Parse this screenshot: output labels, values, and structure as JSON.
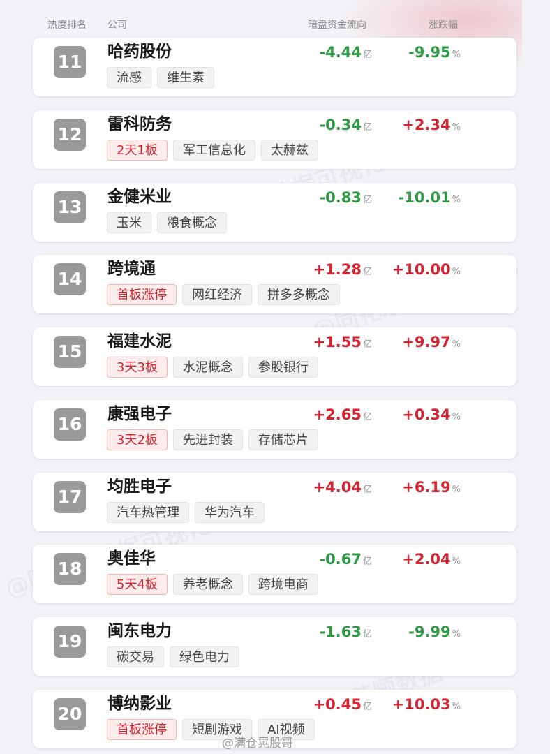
{
  "header": {
    "rank_label": "热度排名",
    "company_label": "公司",
    "flow_label": "暗盘资金流向",
    "change_label": "涨跌幅"
  },
  "unit_flow": "亿",
  "unit_change": "%",
  "watermark": "@同花顺数据可视化",
  "footer_mark": "@满仓晃股哥",
  "rows": [
    {
      "rank": "11",
      "name": "哈药股份",
      "flow": "-4.44",
      "change": "-9.95",
      "tags": [
        {
          "text": "流感",
          "hot": false
        },
        {
          "text": "维生素",
          "hot": false
        }
      ]
    },
    {
      "rank": "12",
      "name": "雷科防务",
      "flow": "-0.34",
      "change": "+2.34",
      "tags": [
        {
          "text": "2天1板",
          "hot": true
        },
        {
          "text": "军工信息化",
          "hot": false
        },
        {
          "text": "太赫兹",
          "hot": false
        }
      ]
    },
    {
      "rank": "13",
      "name": "金健米业",
      "flow": "-0.83",
      "change": "-10.01",
      "tags": [
        {
          "text": "玉米",
          "hot": false
        },
        {
          "text": "粮食概念",
          "hot": false
        }
      ]
    },
    {
      "rank": "14",
      "name": "跨境通",
      "flow": "+1.28",
      "change": "+10.00",
      "tags": [
        {
          "text": "首板涨停",
          "hot": true
        },
        {
          "text": "网红经济",
          "hot": false
        },
        {
          "text": "拼多多概念",
          "hot": false
        }
      ]
    },
    {
      "rank": "15",
      "name": "福建水泥",
      "flow": "+1.55",
      "change": "+9.97",
      "tags": [
        {
          "text": "3天3板",
          "hot": true
        },
        {
          "text": "水泥概念",
          "hot": false
        },
        {
          "text": "参股银行",
          "hot": false
        }
      ]
    },
    {
      "rank": "16",
      "name": "康强电子",
      "flow": "+2.65",
      "change": "+0.34",
      "tags": [
        {
          "text": "3天2板",
          "hot": true
        },
        {
          "text": "先进封装",
          "hot": false
        },
        {
          "text": "存储芯片",
          "hot": false
        }
      ]
    },
    {
      "rank": "17",
      "name": "均胜电子",
      "flow": "+4.04",
      "change": "+6.19",
      "tags": [
        {
          "text": "汽车热管理",
          "hot": false
        },
        {
          "text": "华为汽车",
          "hot": false
        }
      ]
    },
    {
      "rank": "18",
      "name": "奥佳华",
      "flow": "-0.67",
      "change": "+2.04",
      "tags": [
        {
          "text": "5天4板",
          "hot": true
        },
        {
          "text": "养老概念",
          "hot": false
        },
        {
          "text": "跨境电商",
          "hot": false
        }
      ]
    },
    {
      "rank": "19",
      "name": "闽东电力",
      "flow": "-1.63",
      "change": "-9.99",
      "tags": [
        {
          "text": "碳交易",
          "hot": false
        },
        {
          "text": "绿色电力",
          "hot": false
        }
      ]
    },
    {
      "rank": "20",
      "name": "博纳影业",
      "flow": "+0.45",
      "change": "+10.03",
      "tags": [
        {
          "text": "首板涨停",
          "hot": true
        },
        {
          "text": "短剧游戏",
          "hot": false
        },
        {
          "text": "AI视频",
          "hot": false
        }
      ]
    }
  ]
}
